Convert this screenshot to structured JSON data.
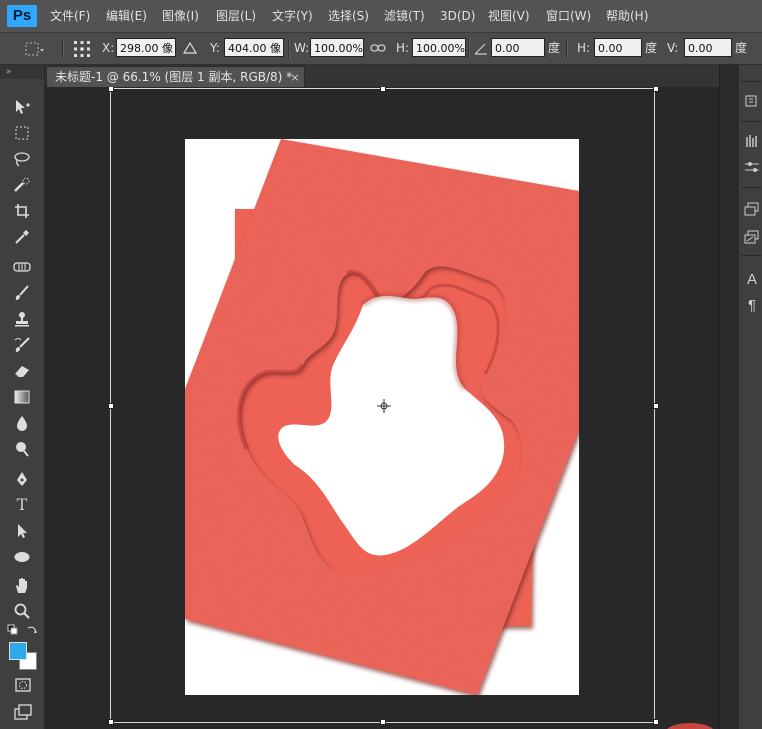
{
  "app": {
    "logo": "Ps"
  },
  "menu": {
    "items": [
      {
        "label": "文件(F)"
      },
      {
        "label": "编辑(E)"
      },
      {
        "label": "图像(I)"
      },
      {
        "label": "图层(L)"
      },
      {
        "label": "文字(Y)"
      },
      {
        "label": "选择(S)"
      },
      {
        "label": "滤镜(T)"
      },
      {
        "label": "3D(D)"
      },
      {
        "label": "视图(V)"
      },
      {
        "label": "窗口(W)"
      },
      {
        "label": "帮助(H)"
      }
    ]
  },
  "options": {
    "x_label": "X:",
    "x_value": "298.00 像",
    "delta_icon": "triangle-icon",
    "y_label": "Y:",
    "y_value": "404.00 像",
    "w_label": "W:",
    "w_value": "100.00%",
    "link_icon": "link-icon",
    "h_label": "H:",
    "h_value": "100.00%",
    "angle_icon": "angle-icon",
    "angle_value": "0.00",
    "angle_unit": "度",
    "hskew_label": "H:",
    "hskew_value": "0.00",
    "hskew_unit": "度",
    "vskew_label": "V:",
    "vskew_value": "0.00",
    "vskew_unit": "度"
  },
  "document": {
    "tab_title": "未标题-1 @ 66.1% (图层 1 副本, RGB/8) *",
    "close_glyph": "×"
  },
  "colors": {
    "foreground": "#2ea9e8",
    "background": "#ffffff",
    "shape_fill": "#ee6257",
    "shape_shadow": "#b23a33"
  },
  "tools": [
    "move-tool-icon",
    "marquee-tool-icon",
    "lasso-tool-icon",
    "quick-select-tool-icon",
    "crop-tool-icon",
    "eyedropper-tool-icon",
    "healing-brush-tool-icon",
    "brush-tool-icon",
    "clone-stamp-tool-icon",
    "history-brush-tool-icon",
    "eraser-tool-icon",
    "gradient-tool-icon",
    "blur-tool-icon",
    "dodge-tool-icon",
    "pen-tool-icon",
    "type-tool-icon",
    "path-select-tool-icon",
    "ellipse-tool-icon",
    "hand-tool-icon",
    "zoom-tool-icon"
  ]
}
